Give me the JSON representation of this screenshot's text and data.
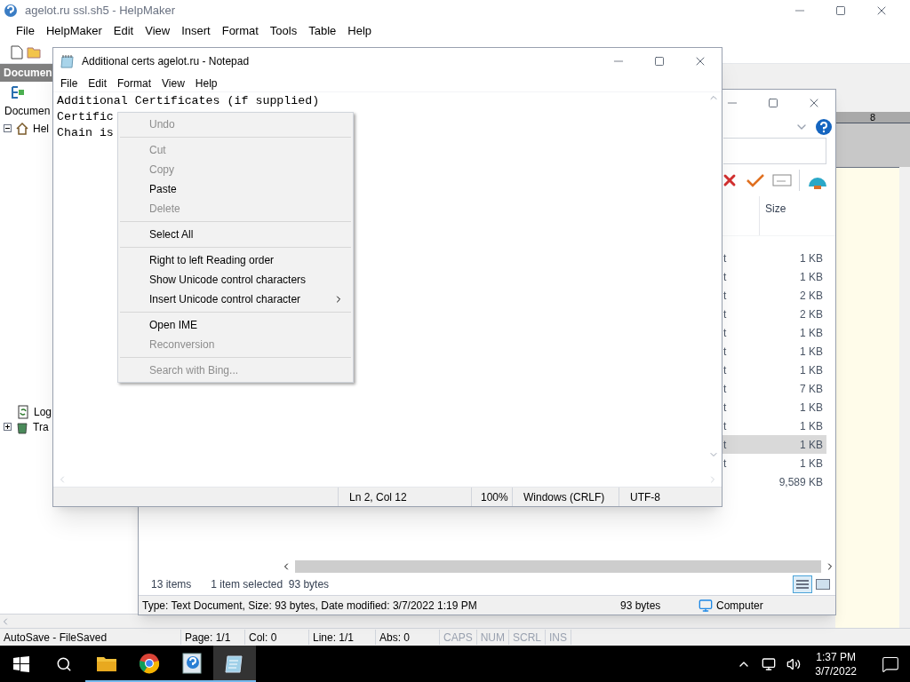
{
  "helpmaker": {
    "title": "agelot.ru ssl.sh5 - HelpMaker",
    "menu": [
      "File",
      "HelpMaker",
      "Edit",
      "View",
      "Insert",
      "Format",
      "Tools",
      "Table",
      "Help"
    ],
    "panel_title": "Documen",
    "panel_label": "Documen",
    "tree": [
      {
        "label": "Hel",
        "expanded": true
      },
      {
        "label": "Log",
        "expanded": false
      },
      {
        "label": "Tra",
        "expanded": false
      }
    ],
    "ruler_mark": "8",
    "status_bar": [
      {
        "text": "AutoSave - FileSaved",
        "disabled": false
      },
      {
        "text": "Page: 1/1",
        "disabled": false
      },
      {
        "text": "Col: 0",
        "disabled": false
      },
      {
        "text": "Line: 1/1",
        "disabled": false
      },
      {
        "text": "Abs: 0",
        "disabled": false
      },
      {
        "text": "CAPS",
        "disabled": true
      },
      {
        "text": "NUM",
        "disabled": true
      },
      {
        "text": "SCRL",
        "disabled": true
      },
      {
        "text": "INS",
        "disabled": true
      }
    ]
  },
  "explorer": {
    "column": "Size",
    "rows": [
      {
        "type": "t",
        "size": "1 KB",
        "selected": false
      },
      {
        "type": "t",
        "size": "1 KB",
        "selected": false
      },
      {
        "type": "t",
        "size": "2 KB",
        "selected": false
      },
      {
        "type": "t",
        "size": "2 KB",
        "selected": false
      },
      {
        "type": "t",
        "size": "1 KB",
        "selected": false
      },
      {
        "type": "t",
        "size": "1 KB",
        "selected": false
      },
      {
        "type": "t",
        "size": "1 KB",
        "selected": false
      },
      {
        "type": "t",
        "size": "7 KB",
        "selected": false
      },
      {
        "type": "t",
        "size": "1 KB",
        "selected": false
      },
      {
        "type": "t",
        "size": "1 KB",
        "selected": false
      },
      {
        "type": "t",
        "size": "1 KB",
        "selected": true
      },
      {
        "type": "t",
        "size": "1 KB",
        "selected": false
      },
      {
        "size": "9,589 KB",
        "selected": false
      }
    ],
    "item_count": "13 items",
    "selection": "1 item selected  93 bytes",
    "status": "Type: Text Document, Size: 93 bytes, Date modified: 3/7/2022 1:19 PM",
    "status_size": "93 bytes",
    "status_location": "Computer"
  },
  "notepad": {
    "title": "Additional certs agelot.ru - Notepad",
    "menu": [
      "File",
      "Edit",
      "Format",
      "View",
      "Help"
    ],
    "lines": [
      "Additional Certificates (if supplied)",
      "Certific",
      "Chain is"
    ],
    "status_bar": [
      "Ln 2, Col 12",
      "100%",
      "Windows (CRLF)",
      "UTF-8"
    ]
  },
  "context_menu": {
    "groups": [
      [
        {
          "label": "Undo",
          "disabled": true,
          "submenu": false
        }
      ],
      [
        {
          "label": "Cut",
          "disabled": true,
          "submenu": false
        },
        {
          "label": "Copy",
          "disabled": true,
          "submenu": false
        },
        {
          "label": "Paste",
          "disabled": false,
          "submenu": false
        },
        {
          "label": "Delete",
          "disabled": true,
          "submenu": false
        }
      ],
      [
        {
          "label": "Select All",
          "disabled": false,
          "submenu": false
        }
      ],
      [
        {
          "label": "Right to left Reading order",
          "disabled": false,
          "submenu": false
        },
        {
          "label": "Show Unicode control characters",
          "disabled": false,
          "submenu": false
        },
        {
          "label": "Insert Unicode control character",
          "disabled": false,
          "submenu": true
        }
      ],
      [
        {
          "label": "Open IME",
          "disabled": false,
          "submenu": false
        },
        {
          "label": "Reconversion",
          "disabled": true,
          "submenu": false
        }
      ],
      [
        {
          "label": "Search with Bing...",
          "disabled": true,
          "submenu": false
        }
      ]
    ]
  },
  "taskbar": {
    "apps": [
      {
        "running": true
      },
      {
        "running": true
      },
      {
        "running": true
      },
      {
        "running": true
      }
    ],
    "time": "1:37 PM",
    "date": "3/7/2022"
  }
}
